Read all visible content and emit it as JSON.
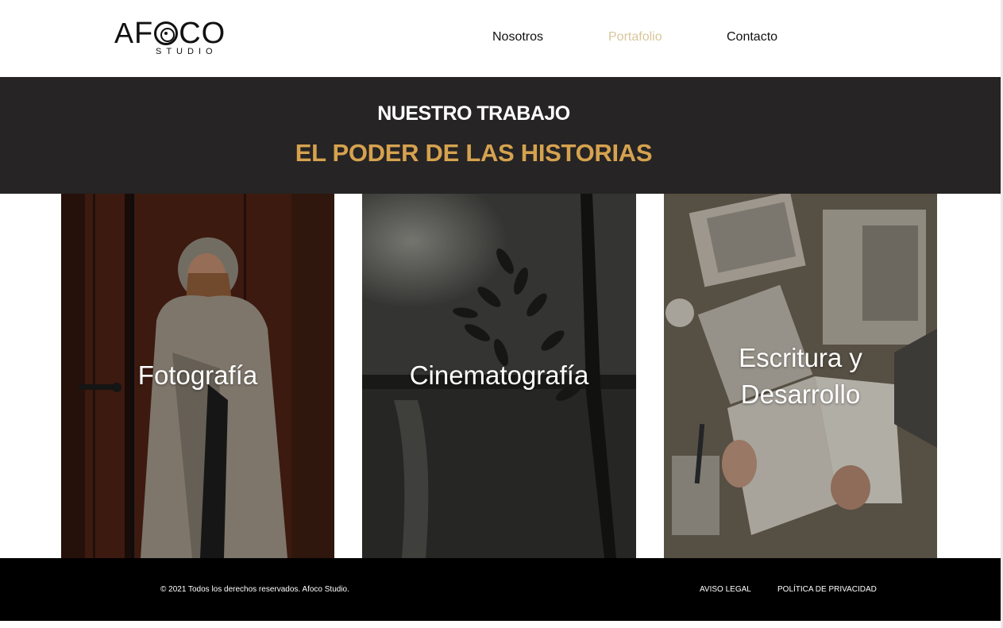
{
  "header": {
    "logo": {
      "main": "AFOCO",
      "sub": "STUDIO"
    },
    "nav": [
      {
        "label": "Nosotros",
        "active": false
      },
      {
        "label": "Portafolio",
        "active": true
      },
      {
        "label": "Contacto",
        "active": false
      }
    ]
  },
  "banner": {
    "title": "NUESTRO TRABAJO",
    "subtitle": "EL PODER DE LAS HISTORIAS"
  },
  "cards": [
    {
      "title": "Fotografía"
    },
    {
      "title": "Cinematografía"
    },
    {
      "title_line1": "Escritura y",
      "title_line2": "Desarrollo"
    }
  ],
  "footer": {
    "copyright": "© 2021 Todos los derechos reservados. Afoco Studio.",
    "links": [
      "AVISO LEGAL",
      "POLÍTICA DE PRIVACIDAD"
    ]
  },
  "colors": {
    "accent_nav_active": "#d9c79a",
    "accent_subtitle": "#d6a24f",
    "banner_bg": "#262424",
    "footer_bg": "#000000"
  }
}
